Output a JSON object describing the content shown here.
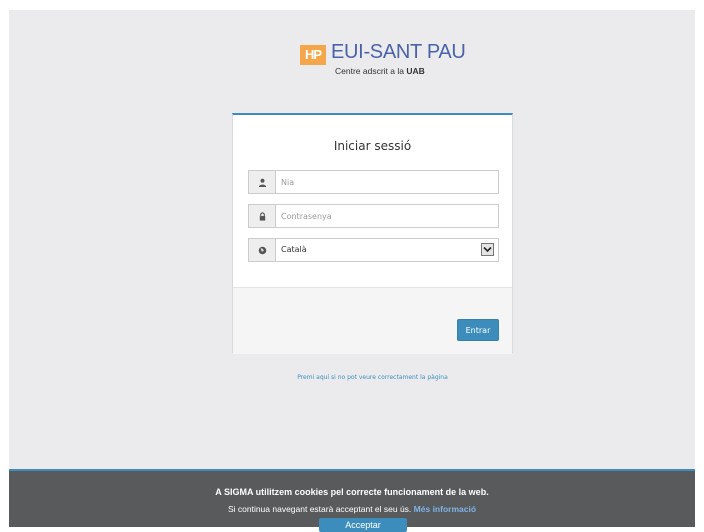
{
  "logo": {
    "mark": "HP",
    "title": "EUI-SANT PAU",
    "subtitle": "Centre adscrit a la",
    "subtitle_bold": "UAB"
  },
  "login": {
    "title": "Iniciar sessió",
    "nia_placeholder": "Nia",
    "password_placeholder": "Contrasenya",
    "language_selected": "Català",
    "submit_label": "Entrar"
  },
  "help_link": "Premi aquí si no pot veure correctament la pàgina",
  "cookies": {
    "line1": "A SIGMA utilitzem cookies pel correcte funcionament de la web.",
    "line2": "Si continua navegant estarà acceptant el seu ús.",
    "more_info": "Més informació",
    "accept_label": "Acceptar"
  },
  "colors": {
    "accent": "#3c8dbc",
    "logo_orange": "#f4a64a",
    "logo_blue": "#4a63a8",
    "cookie_bar": "#595a5c"
  },
  "icons": {
    "nia": "user-icon",
    "password": "lock-icon",
    "language": "globe-icon",
    "dropdown": "chevron-down-icon"
  }
}
